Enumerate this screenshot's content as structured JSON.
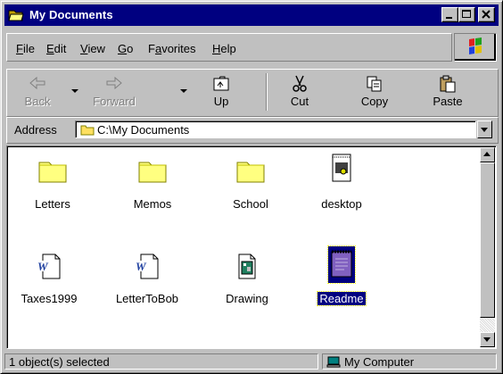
{
  "window": {
    "title": "My Documents",
    "icon": "open-folder-icon",
    "controls": [
      "minimize-icon",
      "maximize-icon",
      "close-icon"
    ]
  },
  "menu": {
    "items": [
      {
        "label": "File",
        "accel": "F",
        "rest": "ile"
      },
      {
        "label": "Edit",
        "accel": "E",
        "rest": "dit"
      },
      {
        "label": "View",
        "accel": "V",
        "rest": "iew"
      },
      {
        "label": "Go",
        "accel": "G",
        "rest": "o"
      },
      {
        "label": "Favorites",
        "pre": "F",
        "accel": "a",
        "rest": "vorites"
      },
      {
        "label": "Help",
        "accel": "H",
        "rest": "elp"
      }
    ],
    "logo_icon": "windows-logo-icon"
  },
  "toolbar": {
    "back": {
      "label": "Back",
      "icon": "back-arrow-icon",
      "enabled": false
    },
    "forward": {
      "label": "Forward",
      "icon": "forward-arrow-icon",
      "enabled": false
    },
    "up": {
      "label": "Up",
      "icon": "up-folder-icon",
      "enabled": true
    },
    "cut": {
      "label": "Cut",
      "icon": "scissors-icon",
      "enabled": true
    },
    "copy": {
      "label": "Copy",
      "icon": "copy-icon",
      "enabled": true
    },
    "paste": {
      "label": "Paste",
      "icon": "paste-icon",
      "enabled": true
    }
  },
  "address": {
    "label": "Address",
    "value": "C:\\My Documents"
  },
  "files": [
    {
      "name": "Letters",
      "icon": "folder-icon",
      "selected": false
    },
    {
      "name": "Memos",
      "icon": "folder-icon",
      "selected": false
    },
    {
      "name": "School",
      "icon": "folder-icon",
      "selected": false
    },
    {
      "name": "desktop",
      "icon": "image-file-icon",
      "selected": false
    },
    {
      "name": "Taxes1999",
      "icon": "word-document-icon",
      "selected": false
    },
    {
      "name": "LetterToBob",
      "icon": "word-document-icon",
      "selected": false
    },
    {
      "name": "Drawing",
      "icon": "paint-file-icon",
      "selected": false
    },
    {
      "name": "Readme",
      "icon": "notepad-file-icon",
      "selected": true
    }
  ],
  "status": {
    "left": "1 object(s) selected",
    "right": "My Computer",
    "right_icon": "my-computer-icon"
  },
  "colors": {
    "title_bar": "#000080",
    "face": "#c0c0c0",
    "selection": "#000080"
  }
}
